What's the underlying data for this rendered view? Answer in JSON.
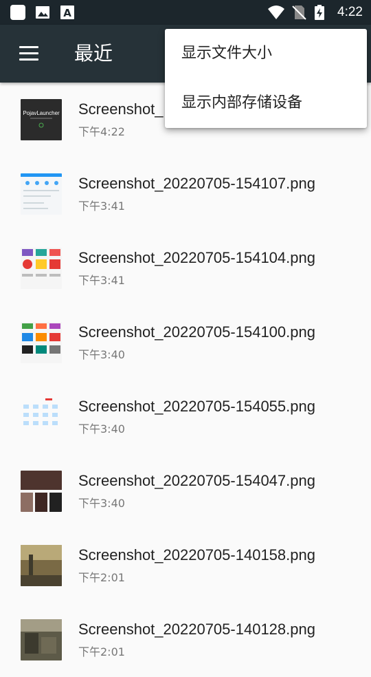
{
  "status_bar": {
    "time": "4:22",
    "left_icons": [
      "app-icon",
      "image-icon",
      "font-a-icon"
    ],
    "right_icons": [
      "wifi-icon",
      "no-sim-icon",
      "battery-charging-icon"
    ]
  },
  "app_bar": {
    "title": "最近",
    "menu_icon": "hamburger-menu-icon"
  },
  "files": [
    {
      "name": "Screenshot_",
      "time": "下午4:22",
      "thumb": "pojav"
    },
    {
      "name": "Screenshot_20220705-154107.png",
      "time": "下午3:41",
      "thumb": "app-list"
    },
    {
      "name": "Screenshot_20220705-154104.png",
      "time": "下午3:41",
      "thumb": "colorful-icons"
    },
    {
      "name": "Screenshot_20220705-154100.png",
      "time": "下午3:40",
      "thumb": "tv-icons"
    },
    {
      "name": "Screenshot_20220705-154055.png",
      "time": "下午3:40",
      "thumb": "grid-icons"
    },
    {
      "name": "Screenshot_20220705-154047.png",
      "time": "下午3:40",
      "thumb": "movie-posters"
    },
    {
      "name": "Screenshot_20220705-140158.png",
      "time": "下午2:01",
      "thumb": "game-scene"
    },
    {
      "name": "Screenshot_20220705-140128.png",
      "time": "下午2:01",
      "thumb": "game-scene-2"
    }
  ],
  "overflow_menu": {
    "items": [
      "显示文件大小",
      "显示内部存储设备"
    ]
  },
  "thumb_texts": {
    "pojav_title": "PojavLauncher"
  },
  "colors": {
    "status_bar": "#1c262c",
    "app_bar": "#263238",
    "background": "#fafafa"
  }
}
